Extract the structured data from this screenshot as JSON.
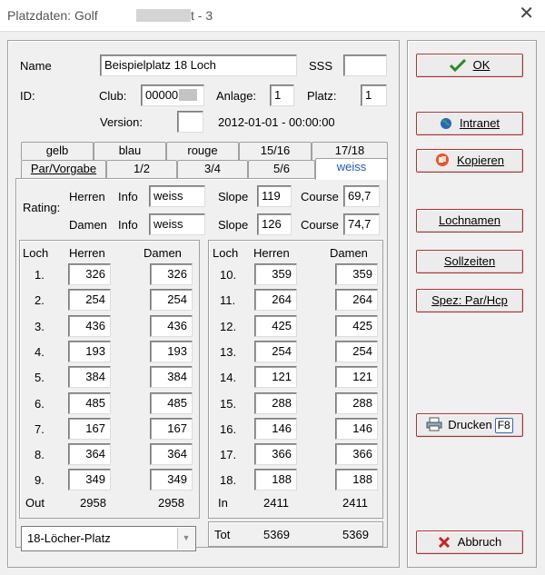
{
  "window": {
    "title": "Platzdaten: Golf",
    "title_suffix": "t - 3",
    "close_glyph": "✕"
  },
  "form": {
    "name_label": "Name",
    "name_value": "Beispielplatz 18 Loch",
    "sss_label": "SSS",
    "sss_value": "",
    "id_label": "ID:",
    "club_label": "Club:",
    "club_value": "00000",
    "anlage_label": "Anlage:",
    "anlage_value": "1",
    "platz_label": "Platz:",
    "platz_value": "1",
    "version_label": "Version:",
    "version_value": "",
    "version_date": "2012-01-01 - 00:00:00"
  },
  "tabs": {
    "row1": [
      "gelb",
      "blau",
      "rouge",
      "15/16",
      "17/18"
    ],
    "row2": [
      "Par/Vorgabe",
      "1/2",
      "3/4",
      "5/6",
      "weiss"
    ]
  },
  "rating": {
    "label": "Rating:",
    "herren_label": "Herren",
    "damen_label": "Damen",
    "info_label": "Info",
    "slope_label": "Slope",
    "course_label": "Course",
    "herren_info": "weiss",
    "herren_slope": "119",
    "herren_course": "69,7",
    "damen_info": "weiss",
    "damen_slope": "126",
    "damen_course": "74,7"
  },
  "holes_table": {
    "col_loch": "Loch",
    "col_herren": "Herren",
    "col_damen": "Damen",
    "front": [
      {
        "hole": "1.",
        "herren": "326",
        "damen": "326"
      },
      {
        "hole": "2.",
        "herren": "254",
        "damen": "254"
      },
      {
        "hole": "3.",
        "herren": "436",
        "damen": "436"
      },
      {
        "hole": "4.",
        "herren": "193",
        "damen": "193"
      },
      {
        "hole": "5.",
        "herren": "384",
        "damen": "384"
      },
      {
        "hole": "6.",
        "herren": "485",
        "damen": "485"
      },
      {
        "hole": "7.",
        "herren": "167",
        "damen": "167"
      },
      {
        "hole": "8.",
        "herren": "364",
        "damen": "364"
      },
      {
        "hole": "9.",
        "herren": "349",
        "damen": "349"
      }
    ],
    "back": [
      {
        "hole": "10.",
        "herren": "359",
        "damen": "359"
      },
      {
        "hole": "11.",
        "herren": "264",
        "damen": "264"
      },
      {
        "hole": "12.",
        "herren": "425",
        "damen": "425"
      },
      {
        "hole": "13.",
        "herren": "254",
        "damen": "254"
      },
      {
        "hole": "14.",
        "herren": "121",
        "damen": "121"
      },
      {
        "hole": "15.",
        "herren": "288",
        "damen": "288"
      },
      {
        "hole": "16.",
        "herren": "146",
        "damen": "146"
      },
      {
        "hole": "17.",
        "herren": "366",
        "damen": "366"
      },
      {
        "hole": "18.",
        "herren": "188",
        "damen": "188"
      }
    ],
    "out_label": "Out",
    "out_herren": "2958",
    "out_damen": "2958",
    "in_label": "In",
    "in_herren": "2411",
    "in_damen": "2411",
    "tot_label": "Tot",
    "tot_herren": "5369",
    "tot_damen": "5369"
  },
  "course_type": {
    "selected": "18-Löcher-Platz",
    "arrow": "▼"
  },
  "buttons": {
    "ok": "OK",
    "intranet": "Intranet",
    "kopieren": "Kopieren",
    "lochnamen": "Lochnamen",
    "sollzeiten": "Sollzeiten",
    "spez": "Spez: Par/Hcp",
    "drucken": "Drucken",
    "drucken_key": "F8",
    "abbruch": "Abbruch"
  },
  "icons": {
    "ok": "checkmark-icon",
    "intranet": "globe-icon",
    "kopieren": "copy-icon",
    "drucken": "printer-icon",
    "abbruch": "x-icon"
  },
  "colors": {
    "ok_check": "#2c8a2c",
    "abbruch_x": "#d02020",
    "active_tab": "#1e56c4",
    "button_border": "#b03030"
  }
}
